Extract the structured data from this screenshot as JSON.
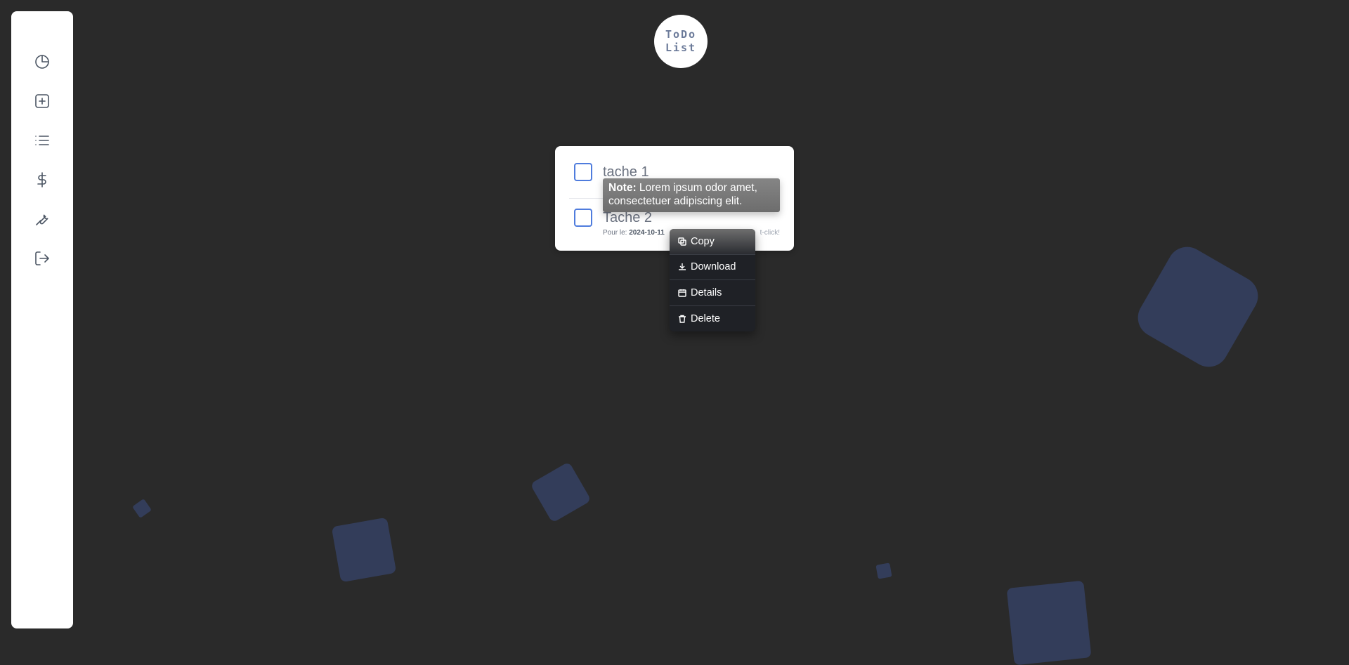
{
  "logo": {
    "line1": "ToDo",
    "line2": "List"
  },
  "sidebar": {
    "items": [
      {
        "icon": "pie-chart-icon"
      },
      {
        "icon": "plus-square-icon"
      },
      {
        "icon": "list-icon"
      },
      {
        "icon": "dollar-icon"
      },
      {
        "icon": "wrench-icon"
      },
      {
        "icon": "logout-icon"
      }
    ]
  },
  "tasks": [
    {
      "title": "tache 1",
      "checked": false
    },
    {
      "title": "Tache 2",
      "checked": false,
      "due_label": "Pour le:",
      "due_date": "2024-10-11",
      "hint": "t-click!"
    }
  ],
  "tooltip": {
    "label": "Note:",
    "text": "Lorem ipsum odor amet, consectetuer adipiscing elit."
  },
  "context_menu": {
    "items": [
      {
        "label": "Copy",
        "icon": "copy-icon"
      },
      {
        "label": "Download",
        "icon": "download-icon"
      },
      {
        "label": "Details",
        "icon": "details-icon"
      },
      {
        "label": "Delete",
        "icon": "trash-icon"
      }
    ]
  },
  "colors": {
    "background": "#2a2a2a",
    "accent": "#4f7cdd",
    "shape": "#333d5a"
  }
}
